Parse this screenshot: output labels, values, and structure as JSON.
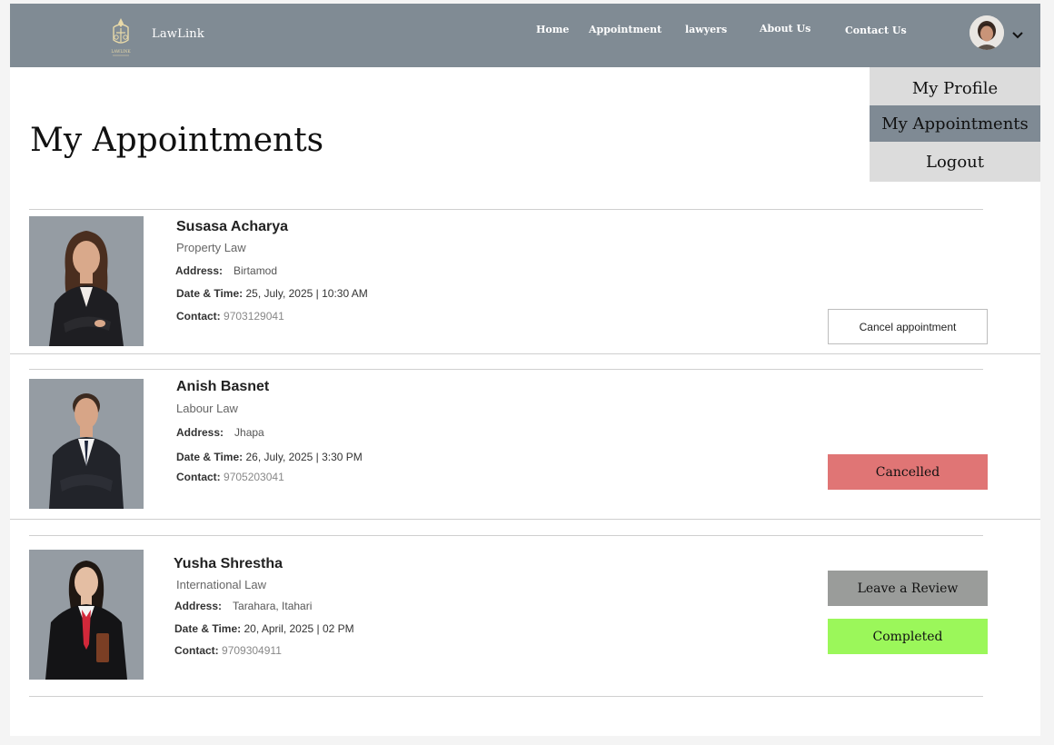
{
  "header": {
    "brand": "LawLink",
    "logo_caption": "LAWLINK",
    "nav": [
      "Home",
      "Appointment",
      "lawyers",
      "About Us",
      "Contact Us"
    ]
  },
  "dropdown": {
    "items": [
      "My Profile",
      "My Appointments",
      "Logout"
    ],
    "active": "My Appointments"
  },
  "page": {
    "title": "My Appointments"
  },
  "labels": {
    "address": "Address:",
    "datetime": "Date & Time:",
    "contact": "Contact:"
  },
  "appointments": [
    {
      "name": "Susasa Acharya",
      "specialty": "Property Law",
      "address": "Birtamod",
      "datetime": "25, July, 2025 |  10:30 AM",
      "contact": "9703129041",
      "action_label": "Cancel appointment"
    },
    {
      "name": "Anish Basnet",
      "specialty": "Labour Law",
      "address": "Jhapa",
      "datetime": "26, July, 2025 |  3:30 PM",
      "contact": "9705203041",
      "status_label": "Cancelled"
    },
    {
      "name": "Yusha Shrestha",
      "specialty": "International Law",
      "address": "Tarahara, Itahari",
      "datetime": "20, April, 2025 |  02 PM",
      "contact": "9709304911",
      "review_label": "Leave a Review",
      "status_label": "Completed"
    }
  ],
  "colors": {
    "navbar": "#808b94",
    "cancelled": "#e07575",
    "completed": "#9bf75a",
    "review": "#9a9c9a",
    "dropdown_bg": "#dcdcdc",
    "dropdown_active": "#7f8a94"
  }
}
